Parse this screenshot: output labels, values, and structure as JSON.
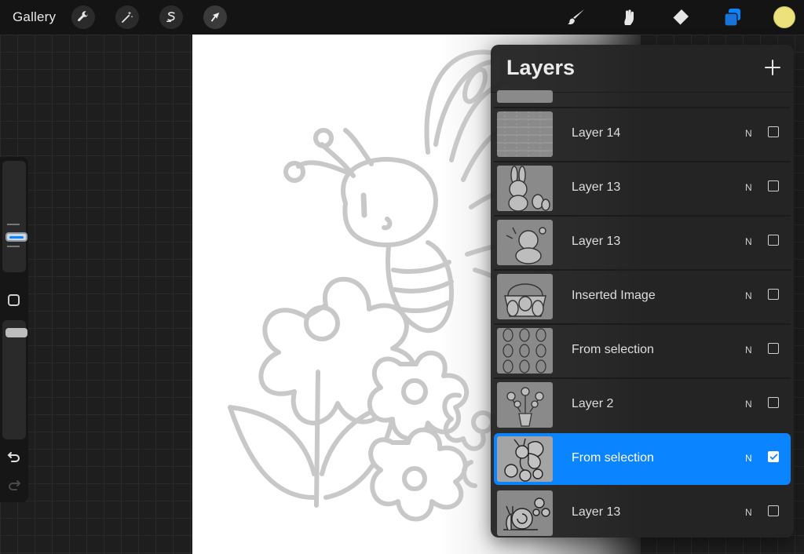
{
  "topbar": {
    "gallery_label": "Gallery",
    "actions_icon": "wrench-icon",
    "adjustments_icon": "magic-wand-icon",
    "selection_icon": "selection-s-icon",
    "transform_icon": "arrow-cursor-icon",
    "brush_icon": "brush-icon",
    "smudge_icon": "smudge-icon",
    "eraser_icon": "eraser-icon",
    "layers_icon": "layers-icon",
    "active_color": "#ece17a"
  },
  "sidebar": {
    "brush_size_level": 0.35,
    "opacity_level": 0.0,
    "undo_icon": "undo-icon",
    "redo_icon": "redo-icon"
  },
  "layers_panel": {
    "title": "Layers",
    "add_icon": "plus-icon",
    "accent_color": "#0a84ff",
    "layers": [
      {
        "name": "Layer 14",
        "mode": "N",
        "visible": false,
        "selected": false,
        "thumb": "pattern"
      },
      {
        "name": "Layer 13",
        "mode": "N",
        "visible": false,
        "selected": false,
        "thumb": "bunny"
      },
      {
        "name": "Layer 13",
        "mode": "N",
        "visible": false,
        "selected": false,
        "thumb": "chick"
      },
      {
        "name": "Inserted Image",
        "mode": "N",
        "visible": false,
        "selected": false,
        "thumb": "basket"
      },
      {
        "name": "From selection",
        "mode": "N",
        "visible": false,
        "selected": false,
        "thumb": "eggs"
      },
      {
        "name": "Layer 2",
        "mode": "N",
        "visible": false,
        "selected": false,
        "thumb": "vase"
      },
      {
        "name": "From selection",
        "mode": "N",
        "visible": true,
        "selected": true,
        "thumb": "butterfly"
      },
      {
        "name": "Layer 13",
        "mode": "N",
        "visible": false,
        "selected": false,
        "thumb": "snail"
      }
    ]
  }
}
